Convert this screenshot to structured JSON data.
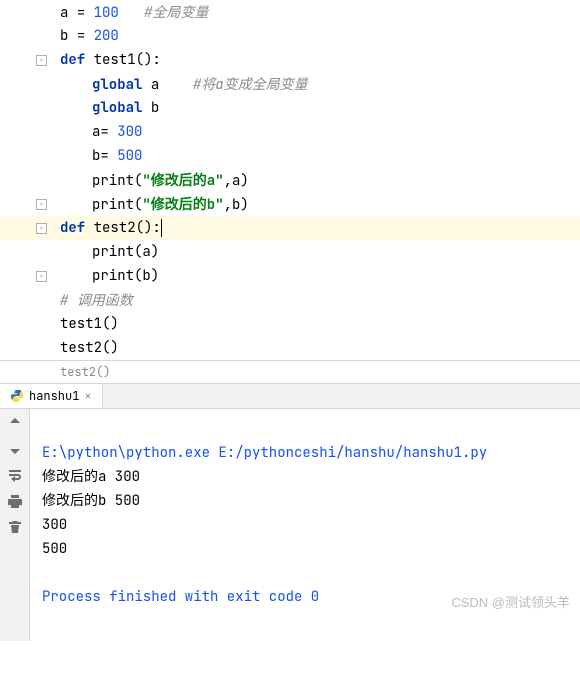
{
  "code": {
    "l1_var": "a ",
    "l1_eq": "= ",
    "l1_num": "100",
    "l1_comment": "   #全局变量",
    "l2_var": "b ",
    "l2_eq": "= ",
    "l2_num": "200",
    "l3_def": "def ",
    "l3_name": "test1",
    "l3_post": "():",
    "l4_kw": "global ",
    "l4_var": "a",
    "l4_comment": "    #将a变成全局变量",
    "l5_kw": "global ",
    "l5_var": "b",
    "l6_var": "a",
    "l6_eq": "= ",
    "l6_num": "300",
    "l7_var": "b",
    "l7_eq": "= ",
    "l7_num": "500",
    "l8_fn": "print",
    "l8_open": "(",
    "l8_str": "\"修改后的a\"",
    "l8_rest": ",a)",
    "l9_fn": "print",
    "l9_open": "(",
    "l9_str": "\"修改后的b\"",
    "l9_rest": ",b)",
    "l10_def": "def ",
    "l10_name": "test2",
    "l10_post": "():",
    "l11_fn": "print",
    "l11_rest": "(a)",
    "l12_fn": "print",
    "l12_rest": "(b)",
    "l13_comment": "# 调用函数",
    "l14": "test1()",
    "l15": "test2()"
  },
  "breadcrumb": "test2()",
  "tab": {
    "name": "hanshu1"
  },
  "output": {
    "l1": "E:\\python\\python.exe E:/pythonceshi/hanshu/hanshu1.py",
    "l2": "修改后的a 300",
    "l3": "修改后的b 500",
    "l4": "300",
    "l5": "500",
    "l6": "",
    "l7": "Process finished with exit code 0"
  },
  "watermark": "CSDN @测试领头羊"
}
